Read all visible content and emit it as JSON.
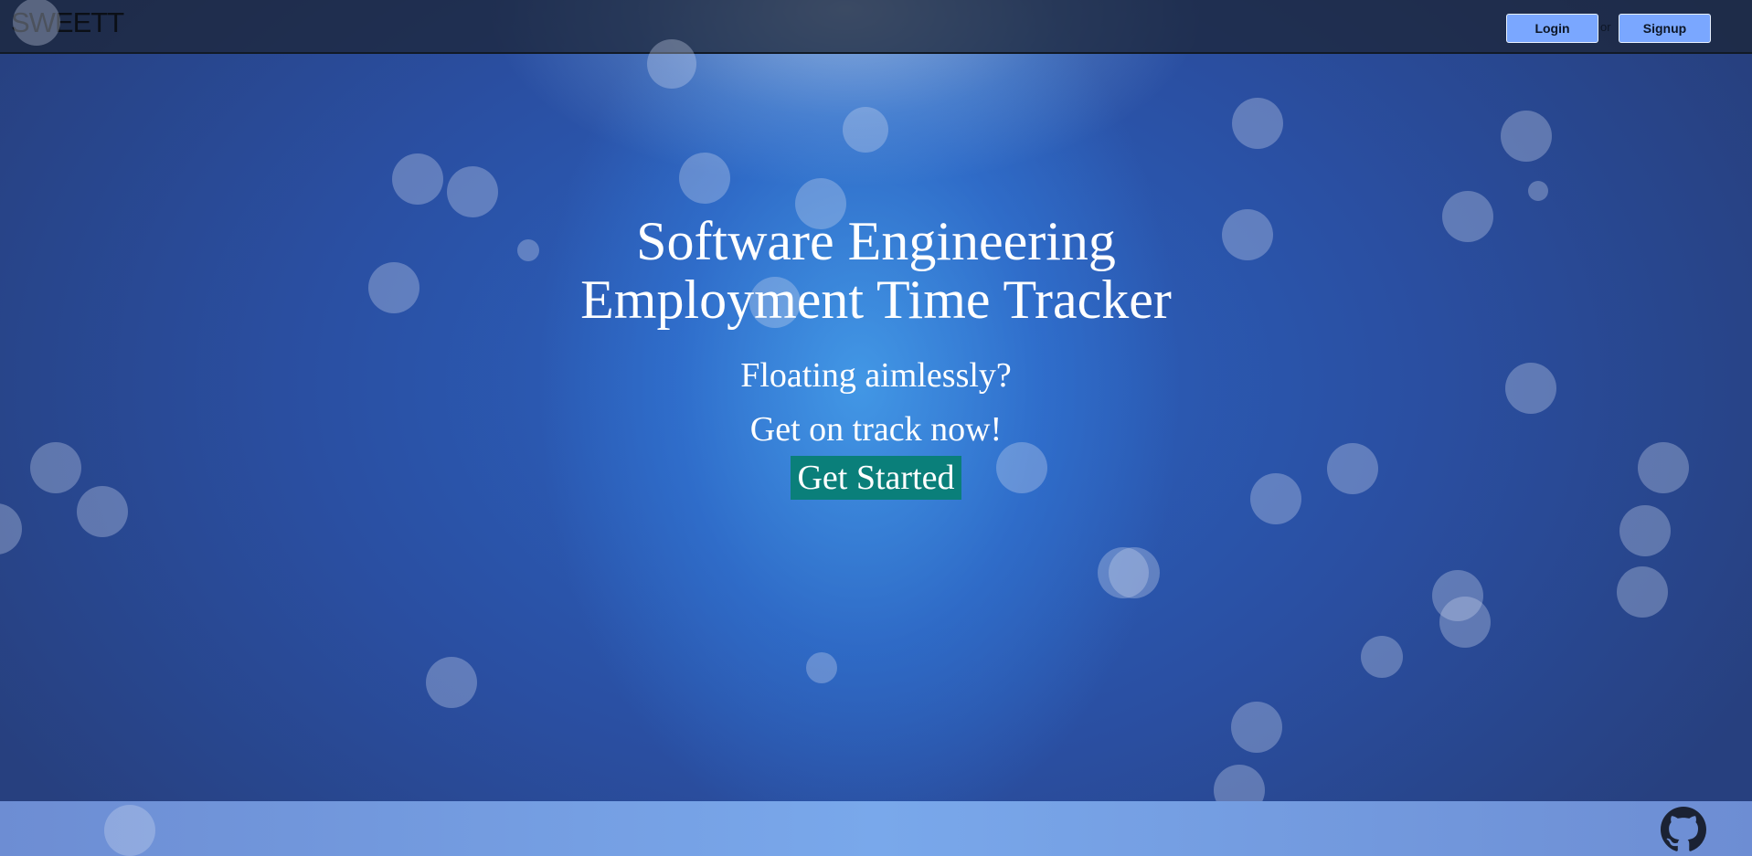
{
  "header": {
    "brand": "SWEETT",
    "login_label": "Login",
    "or_text": "or",
    "signup_label": "Signup"
  },
  "hero": {
    "title_line1": "Software Engineering",
    "title_line2": "Employment Time Tracker",
    "subtitle1": "Floating aimlessly?",
    "subtitle2": "Get on track now!",
    "cta_label": "Get Started"
  },
  "footer": {
    "github_icon": "github-icon"
  },
  "colors": {
    "cta_background": "#0a7f7a",
    "auth_button": "#7aa7ff",
    "footer": "#79a8eb"
  }
}
